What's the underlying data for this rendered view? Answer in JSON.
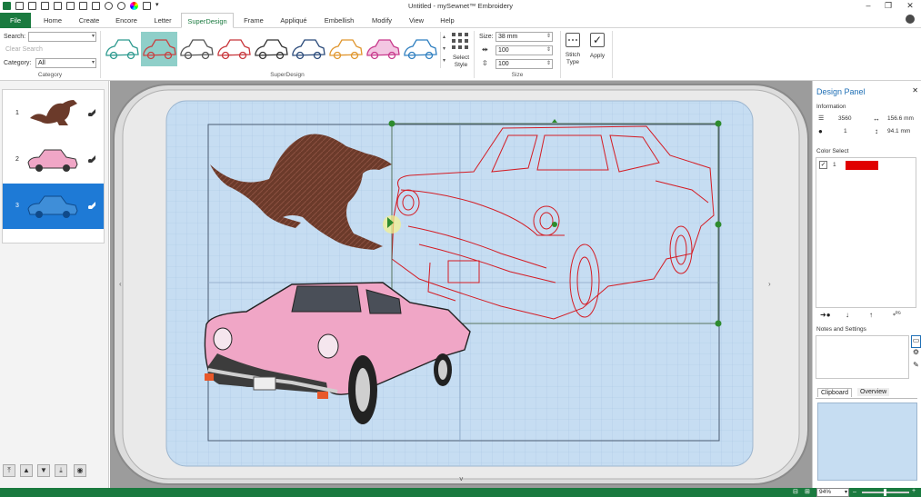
{
  "window": {
    "title": "Untitled - mySewnet™ Embroidery",
    "quick_access_icons": [
      "app-icon",
      "new-icon",
      "save-icon",
      "open-icon",
      "print-icon",
      "folder-icon",
      "export-icon",
      "copy-icon",
      "undo-icon",
      "redo-icon",
      "color-wheel-icon",
      "preview-icon",
      "dropdown-icon"
    ],
    "controls": [
      "minimize-icon",
      "restore-icon",
      "close-icon"
    ]
  },
  "ribbon_tabs": {
    "file": "File",
    "tabs": [
      "Home",
      "Create",
      "Encore",
      "Letter",
      "SuperDesign",
      "Frame",
      "Appliqué",
      "Embellish",
      "Modify",
      "View",
      "Help"
    ],
    "active": "SuperDesign"
  },
  "category_group": {
    "search_label": "Search:",
    "search_value": "",
    "clear_search": "Clear Search",
    "category_label": "Category:",
    "category_value": "All",
    "group_label": "Category"
  },
  "superdesign_group": {
    "group_label": "SuperDesign",
    "select_style_label": "Select Style",
    "thumbnails": [
      {
        "name": "vw-beetle",
        "color": "#2d9a8f"
      },
      {
        "name": "cadillac-red",
        "color": "#c84040"
      },
      {
        "name": "sports-car-grey",
        "color": "#555555"
      },
      {
        "name": "race-car-red",
        "color": "#c8363b"
      },
      {
        "name": "classic-car-black",
        "color": "#333333"
      },
      {
        "name": "jeep-navy",
        "color": "#2a4a7a"
      },
      {
        "name": "roadster-orange",
        "color": "#e0962e"
      },
      {
        "name": "vw-bus-pink",
        "color": "#c83a8c"
      },
      {
        "name": "sedan-blue",
        "color": "#2f7fc0"
      }
    ]
  },
  "size_group": {
    "group_label": "Size",
    "size_label": "Size:",
    "size_value": "38 mm",
    "width_value": "100",
    "height_value": "100"
  },
  "stitch_group": {
    "stitch_type_label": "Stitch Type",
    "apply_label": "Apply"
  },
  "layers": [
    {
      "num": "1",
      "name": "kangaroo"
    },
    {
      "num": "2",
      "name": "pink-cadillac"
    },
    {
      "num": "3",
      "name": "blue-car",
      "selected": true
    }
  ],
  "design_panel": {
    "title": "Design Panel",
    "information_label": "Information",
    "stitches": "3560",
    "width": "156.6 mm",
    "colors": "1",
    "height": "94.1 mm",
    "color_select_label": "Color Select",
    "color_items": [
      {
        "num": "1",
        "color": "#e00000"
      }
    ],
    "notes_label": "Notes and Settings",
    "tabs": [
      "Clipboard",
      "Overview"
    ]
  },
  "status": {
    "zoom": "94%"
  },
  "colors": {
    "brand_green": "#1a7a3f",
    "hoop_blue": "#c6ddf2",
    "selection_green": "#2e8b2e",
    "outline_red": "#d41c24",
    "kangaroo_brown": "#6b3a2a",
    "car_pink": "#f0a6c6"
  }
}
